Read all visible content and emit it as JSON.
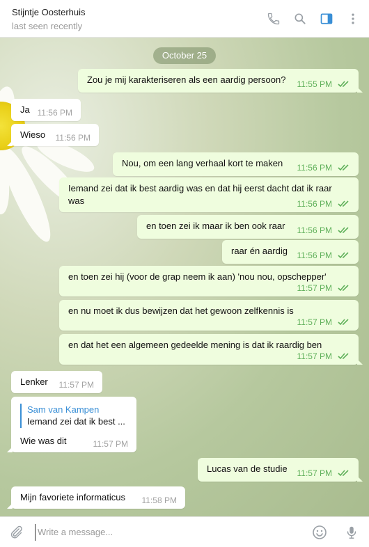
{
  "header": {
    "contact_name": "Stijntje Oosterhuis",
    "status": "last seen recently",
    "icons": [
      "phone-icon",
      "search-icon",
      "sidebar-toggle-icon",
      "more-vertical-icon"
    ]
  },
  "chat": {
    "date_separator": "October 25",
    "messages": [
      {
        "dir": "out",
        "text": "Zou je mij karakteriseren als een aardig persoon?",
        "time": "11:55 PM"
      },
      {
        "dir": "in",
        "text": "Ja",
        "time": "11:56 PM"
      },
      {
        "dir": "in",
        "text": "Wieso",
        "time": "11:56 PM"
      },
      {
        "dir": "out",
        "text": "Nou, om een lang verhaal kort te maken",
        "time": "11:56 PM"
      },
      {
        "dir": "out",
        "text": "Iemand zei dat ik best aardig was en dat hij eerst dacht dat ik raar was",
        "time": "11:56 PM"
      },
      {
        "dir": "out",
        "text": "en toen zei ik maar ik ben ook raar",
        "time": "11:56 PM"
      },
      {
        "dir": "out",
        "text": "raar én aardig",
        "time": "11:56 PM"
      },
      {
        "dir": "out",
        "text": "en toen zei hij (voor de grap neem ik aan) 'nou nou, opschepper'",
        "time": "11:57 PM"
      },
      {
        "dir": "out",
        "text": "en nu moet ik dus bewijzen dat het gewoon zelfkennis is",
        "time": "11:57 PM"
      },
      {
        "dir": "out",
        "text": "en dat het een algemeen gedeelde mening is dat ik raardig ben",
        "time": "11:57 PM"
      },
      {
        "dir": "in",
        "text": "Lenker",
        "time": "11:57 PM"
      },
      {
        "dir": "in",
        "reply_name": "Sam van Kampen",
        "reply_text": "Iemand zei dat ik best ...",
        "text": "Wie was dit",
        "time": "11:57 PM"
      },
      {
        "dir": "out",
        "text": "Lucas van de studie",
        "time": "11:57 PM"
      },
      {
        "dir": "in",
        "text": "Mijn favoriete informaticus",
        "time": "11:58 PM"
      }
    ]
  },
  "composer": {
    "placeholder": "Write a message...",
    "icons": [
      "attach-icon",
      "emoji-icon",
      "microphone-icon"
    ]
  },
  "colors": {
    "outgoing_bubble": "#effdde",
    "incoming_bubble": "#ffffff",
    "accent": "#3a8fd6",
    "read_ticks": "#5fb05a"
  }
}
